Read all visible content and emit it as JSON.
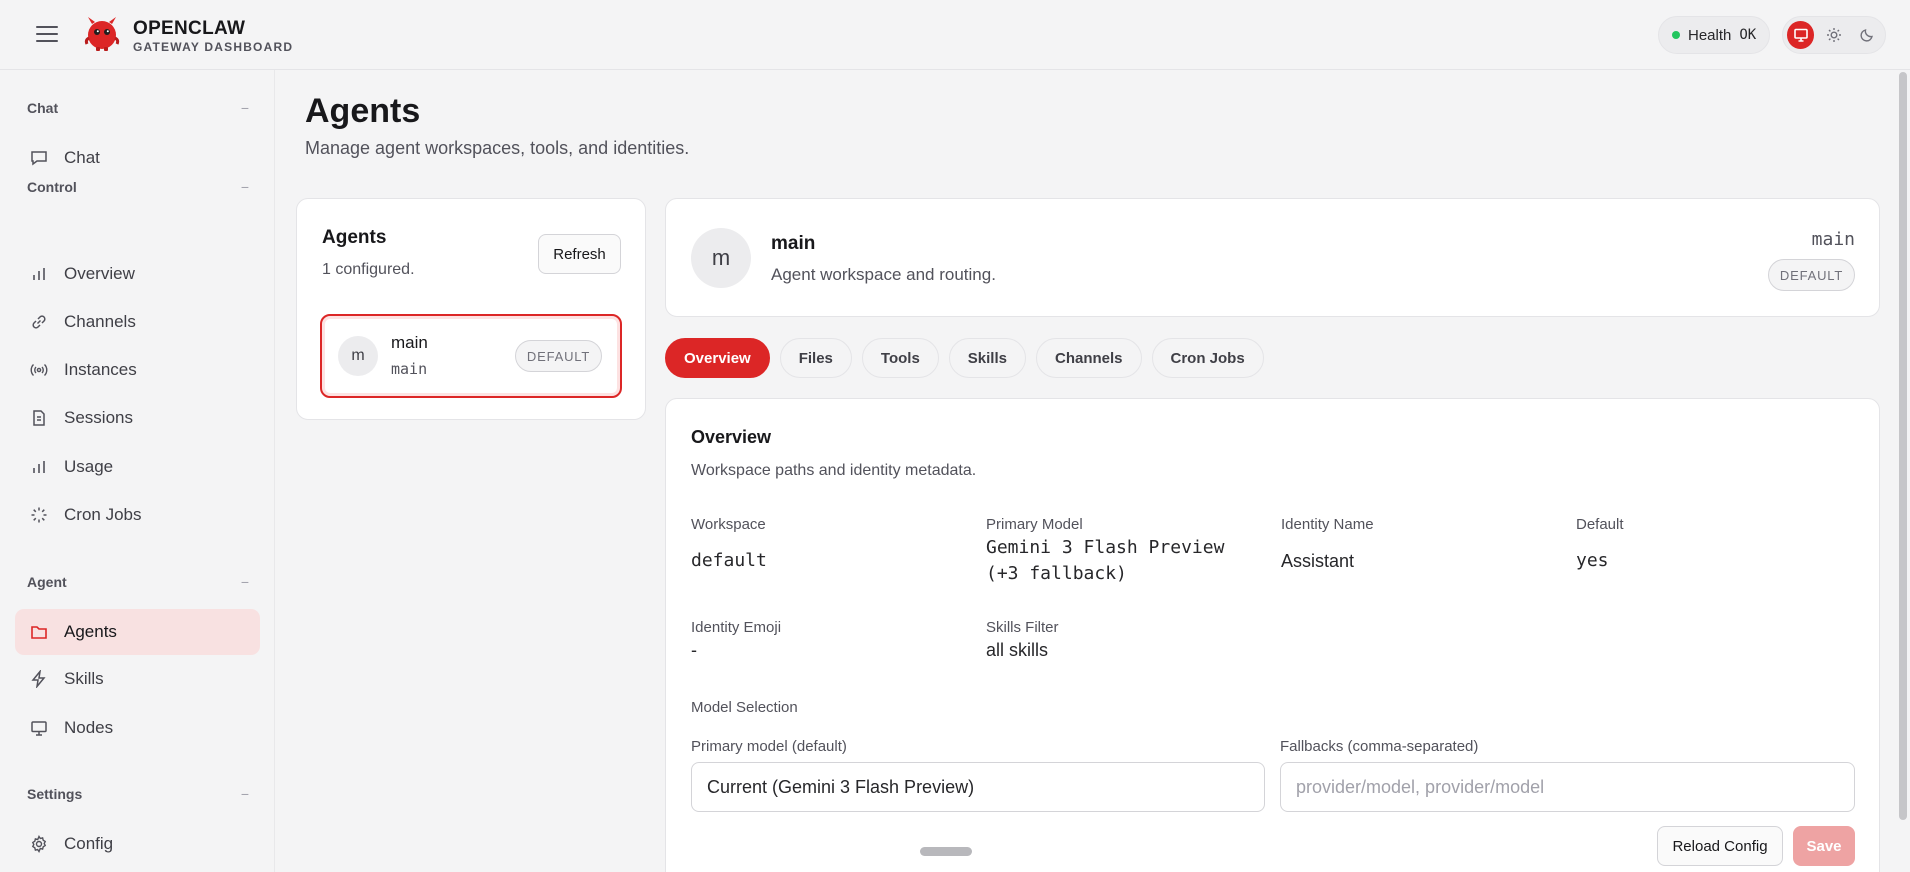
{
  "topbar": {
    "brand_title": "OPENCLAW",
    "brand_subtitle": "GATEWAY DASHBOARD",
    "health_label": "Health",
    "health_value": "OK",
    "theme_modes": [
      "system",
      "light",
      "dark"
    ],
    "theme_active": "system"
  },
  "sidebar": {
    "groups": [
      {
        "label": "Chat",
        "collapse": "−",
        "items": [
          {
            "label": "Chat",
            "icon": "chat-bubble-icon"
          }
        ]
      },
      {
        "label": "Control",
        "collapse": "−",
        "items": [
          {
            "label": "Overview",
            "icon": "bar-chart-icon"
          },
          {
            "label": "Channels",
            "icon": "link-icon"
          },
          {
            "label": "Instances",
            "icon": "radio-signal-icon"
          },
          {
            "label": "Sessions",
            "icon": "document-icon"
          },
          {
            "label": "Usage",
            "icon": "bar-chart-icon"
          },
          {
            "label": "Cron Jobs",
            "icon": "loader-icon"
          }
        ]
      },
      {
        "label": "Agent",
        "collapse": "−",
        "items": [
          {
            "label": "Agents",
            "icon": "folder-icon",
            "active": true
          },
          {
            "label": "Skills",
            "icon": "lightning-icon"
          },
          {
            "label": "Nodes",
            "icon": "monitor-icon"
          }
        ]
      },
      {
        "label": "Settings",
        "collapse": "−",
        "items": [
          {
            "label": "Config",
            "icon": "gear-icon"
          }
        ]
      }
    ]
  },
  "page": {
    "title": "Agents",
    "subtitle": "Manage agent workspaces, tools, and identities."
  },
  "agents_panel": {
    "title": "Agents",
    "count": "1 configured.",
    "refresh_label": "Refresh",
    "items": [
      {
        "avatar": "m",
        "name": "main",
        "id": "main",
        "badge": "DEFAULT"
      }
    ]
  },
  "agent_header": {
    "avatar": "m",
    "name": "main",
    "description": "Agent workspace and routing.",
    "id": "main",
    "badge": "DEFAULT"
  },
  "tabs": [
    "Overview",
    "Files",
    "Tools",
    "Skills",
    "Channels",
    "Cron Jobs"
  ],
  "active_tab": "Overview",
  "overview": {
    "title": "Overview",
    "subtitle": "Workspace paths and identity metadata.",
    "fields": {
      "workspace_label": "Workspace",
      "workspace_value": "default",
      "primary_model_label": "Primary Model",
      "primary_model_value": "Gemini 3 Flash Preview (+3 fallback)",
      "identity_name_label": "Identity Name",
      "identity_name_value": "Assistant",
      "default_label": "Default",
      "default_value": "yes",
      "identity_emoji_label": "Identity Emoji",
      "identity_emoji_value": "-",
      "skills_filter_label": "Skills Filter",
      "skills_filter_value": "all skills"
    },
    "model_selection_label": "Model Selection",
    "primary_model_input_label": "Primary model (default)",
    "primary_model_input_value": "Current (Gemini 3 Flash Preview)",
    "fallbacks_label": "Fallbacks (comma-separated)",
    "fallbacks_placeholder": "provider/model, provider/model",
    "reload_label": "Reload Config",
    "save_label": "Save"
  },
  "colors": {
    "accent": "#dc2626",
    "accent_soft": "#f8e1e1",
    "health_dot": "#22c55e"
  }
}
